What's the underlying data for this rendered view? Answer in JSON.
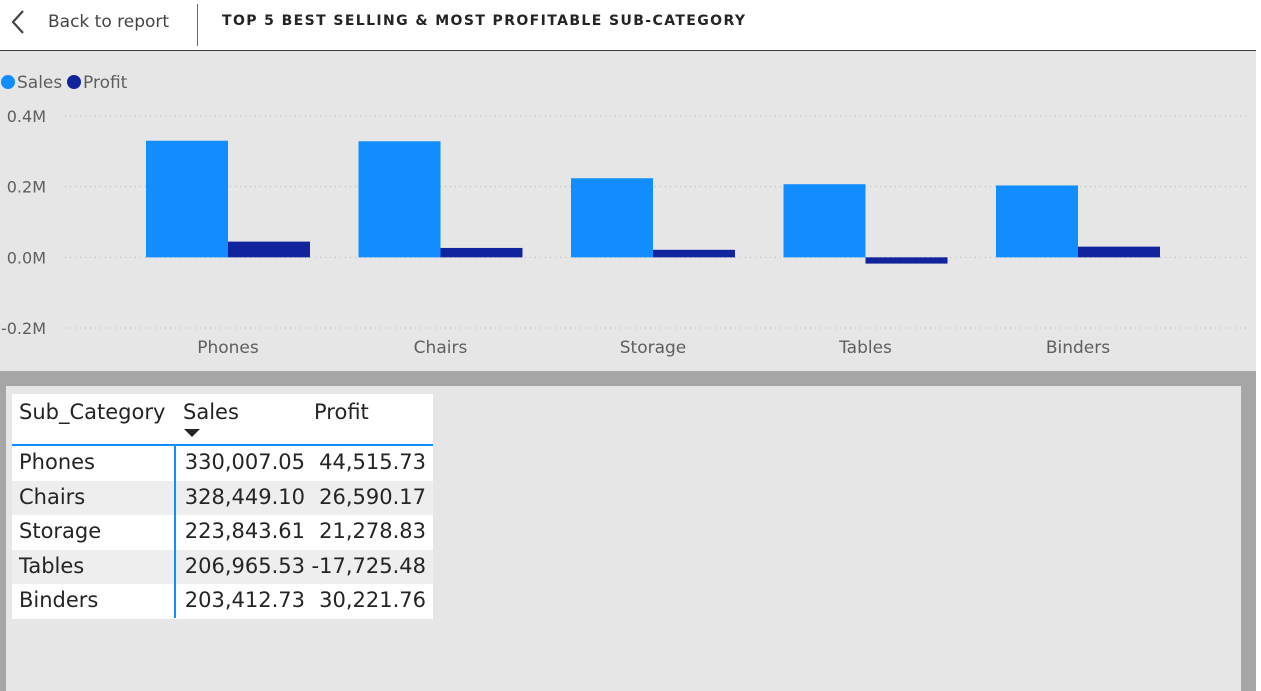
{
  "header": {
    "back_label": "Back to report",
    "title": "TOP 5 BEST SELLING & MOST PROFITABLE SUB-CATEGORY"
  },
  "colors": {
    "sales": "#118dff",
    "profit": "#12239e"
  },
  "chart_data": {
    "type": "bar",
    "categories": [
      "Phones",
      "Chairs",
      "Storage",
      "Tables",
      "Binders"
    ],
    "series": [
      {
        "name": "Sales",
        "values": [
          330007.05,
          328449.1,
          223843.61,
          206965.53,
          203412.73
        ]
      },
      {
        "name": "Profit",
        "values": [
          44515.73,
          26590.17,
          21278.83,
          -17725.48,
          30221.76
        ]
      }
    ],
    "yticks": [
      {
        "value": 400000,
        "label": "0.4M"
      },
      {
        "value": 200000,
        "label": "0.2M"
      },
      {
        "value": 0,
        "label": "0.0M"
      },
      {
        "value": -200000,
        "label": "-0.2M"
      }
    ],
    "ylim": [
      -200000,
      400000
    ],
    "legend": "top-left",
    "grid": true
  },
  "table": {
    "headers": [
      "Sub_Category",
      "Sales",
      "Profit"
    ],
    "sort_icon": "sort-descending-icon",
    "rows": [
      [
        "Phones",
        "330,007.05",
        "44,515.73"
      ],
      [
        "Chairs",
        "328,449.10",
        "26,590.17"
      ],
      [
        "Storage",
        "223,843.61",
        "21,278.83"
      ],
      [
        "Tables",
        "206,965.53",
        "-17,725.48"
      ],
      [
        "Binders",
        "203,412.73",
        "30,221.76"
      ]
    ]
  }
}
